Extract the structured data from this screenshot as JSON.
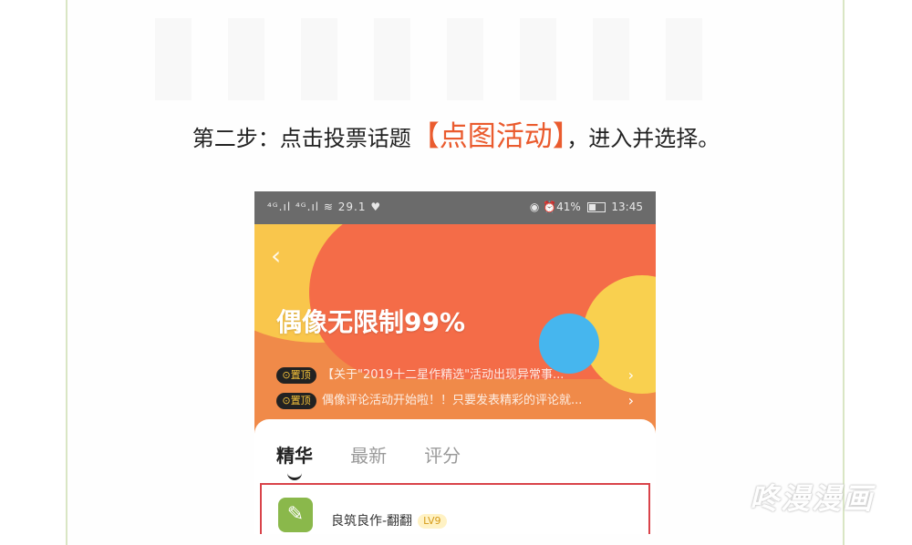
{
  "instruction": {
    "prefix": "第二步：点击投票话题",
    "highlight": "【点图活动】",
    "suffix": "，进入并选择。",
    "highlight_color": "#ea5b2e"
  },
  "status_bar": {
    "left_icons": "⁴ᴳ.ıl ⁴ᴳ.ıl ≋ 29.1 ♥",
    "right_text": "◉ ⏰41%",
    "time": "13:45"
  },
  "banner": {
    "back_icon": "chevron-left-icon",
    "title": "偶像无限制99%",
    "colors": {
      "orange": "#f08a49",
      "red": "#f46c48",
      "yellow": "#f9c64c",
      "blue": "#46b6ee"
    }
  },
  "pinned": [
    {
      "tag": "⊙置顶",
      "text": "【关于\"2019十二星作精选\"活动出现异常事..."
    },
    {
      "tag": "⊙置顶",
      "text": "偶像评论活动开始啦！！只要发表精彩的评论就..."
    }
  ],
  "tabs": [
    "精华",
    "最新",
    "评分"
  ],
  "post": {
    "author": "良筑良作-翻翻",
    "level": "LV9"
  },
  "watermark": "咚漫漫画"
}
